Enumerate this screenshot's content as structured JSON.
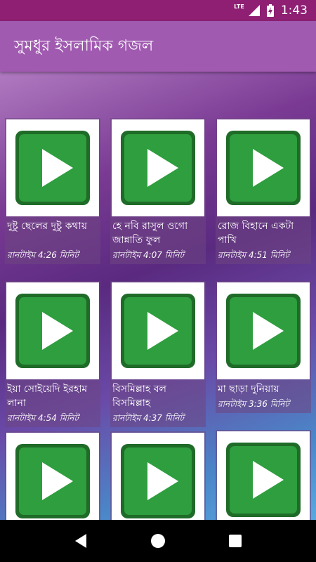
{
  "status_bar": {
    "network_label": "LTE",
    "time": "1:43",
    "icons": [
      "signal-icon",
      "battery-charging-icon"
    ]
  },
  "app_bar": {
    "title": "সুমধুর ইসলামিক গজল"
  },
  "videos": [
    {
      "title": "দুষ্টু ছেলের দুষ্টু কথায়",
      "runtime": "রানটাইম 4:26 মিনিট",
      "icon": "play-icon"
    },
    {
      "title": "হে নবি রাসুল ওগো জান্নাতি ফুল",
      "runtime": "রানটাইম 4:07 মিনিট",
      "icon": "play-icon"
    },
    {
      "title": "রোজ বিহানে একটা পাখি",
      "runtime": "রানটাইম 4:51 মিনিট",
      "icon": "play-icon"
    },
    {
      "title": "ইয়া সোইয়েদি ইরহাম লানা",
      "runtime": "রানটাইম 4:54 মিনিট",
      "icon": "play-icon"
    },
    {
      "title": "বিসমিল্লাহ বল বিসমিল্লাহ",
      "runtime": "রানটাইম 4:37 মিনিট",
      "icon": "play-icon"
    },
    {
      "title": "মা ছাড়া দুনিয়ায়",
      "runtime": "রানটাইম 3:36 মিনিট",
      "icon": "play-icon"
    },
    {
      "title": "",
      "runtime": "",
      "icon": "play-icon"
    },
    {
      "title": "",
      "runtime": "",
      "icon": "play-icon"
    },
    {
      "title": "",
      "runtime": "",
      "icon": "play-icon"
    }
  ],
  "nav_bar": {
    "buttons": [
      "back-icon",
      "home-icon",
      "recents-icon"
    ]
  },
  "colors": {
    "status_bar": "#8e1f73",
    "app_bar": "#a05ab0",
    "play_green": "#2e9e3e",
    "play_border": "#1f6b28"
  }
}
